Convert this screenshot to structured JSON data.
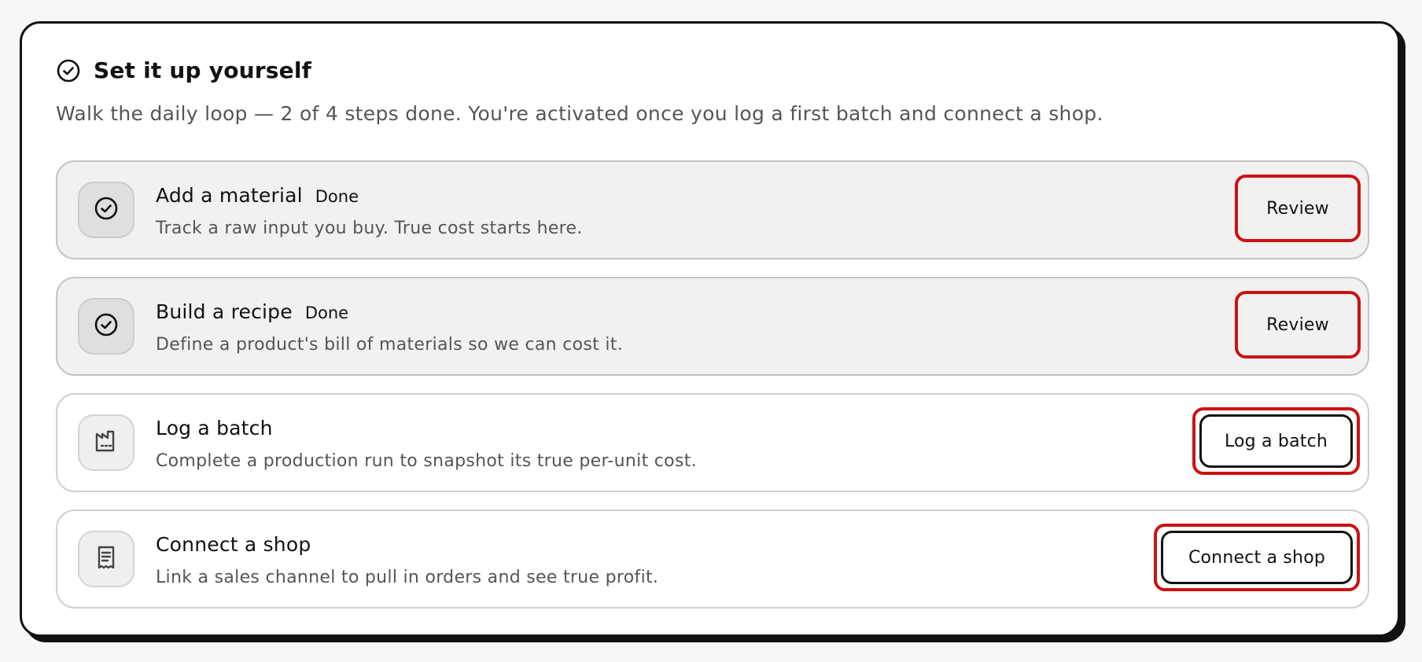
{
  "panel": {
    "title": "Set it up yourself",
    "subtitle": "Walk the daily loop — 2 of 4 steps done. You're activated once you log a first batch and connect a shop.",
    "header_icon": "check-circle-icon",
    "progress": {
      "done": 2,
      "total": 4
    }
  },
  "steps": [
    {
      "title": "Add a material",
      "status": "Done",
      "description": "Track a raw input you buy. True cost starts here.",
      "action": "Review",
      "icon": "check-circle-icon"
    },
    {
      "title": "Build a recipe",
      "status": "Done",
      "description": "Define a product's bill of materials so we can cost it.",
      "action": "Review",
      "icon": "check-circle-icon"
    },
    {
      "title": "Log a batch",
      "description": "Complete a production run to snapshot its true per-unit cost.",
      "action": "Log a batch",
      "icon": "factory-icon"
    },
    {
      "title": "Connect a shop",
      "description": "Link a sales channel to pull in orders and see true profit.",
      "action": "Connect a shop",
      "icon": "receipt-icon"
    }
  ],
  "colors": {
    "highlight": "#cc1111",
    "ink": "#111111",
    "muted": "#555555",
    "done_bg": "#f1f1f1"
  }
}
